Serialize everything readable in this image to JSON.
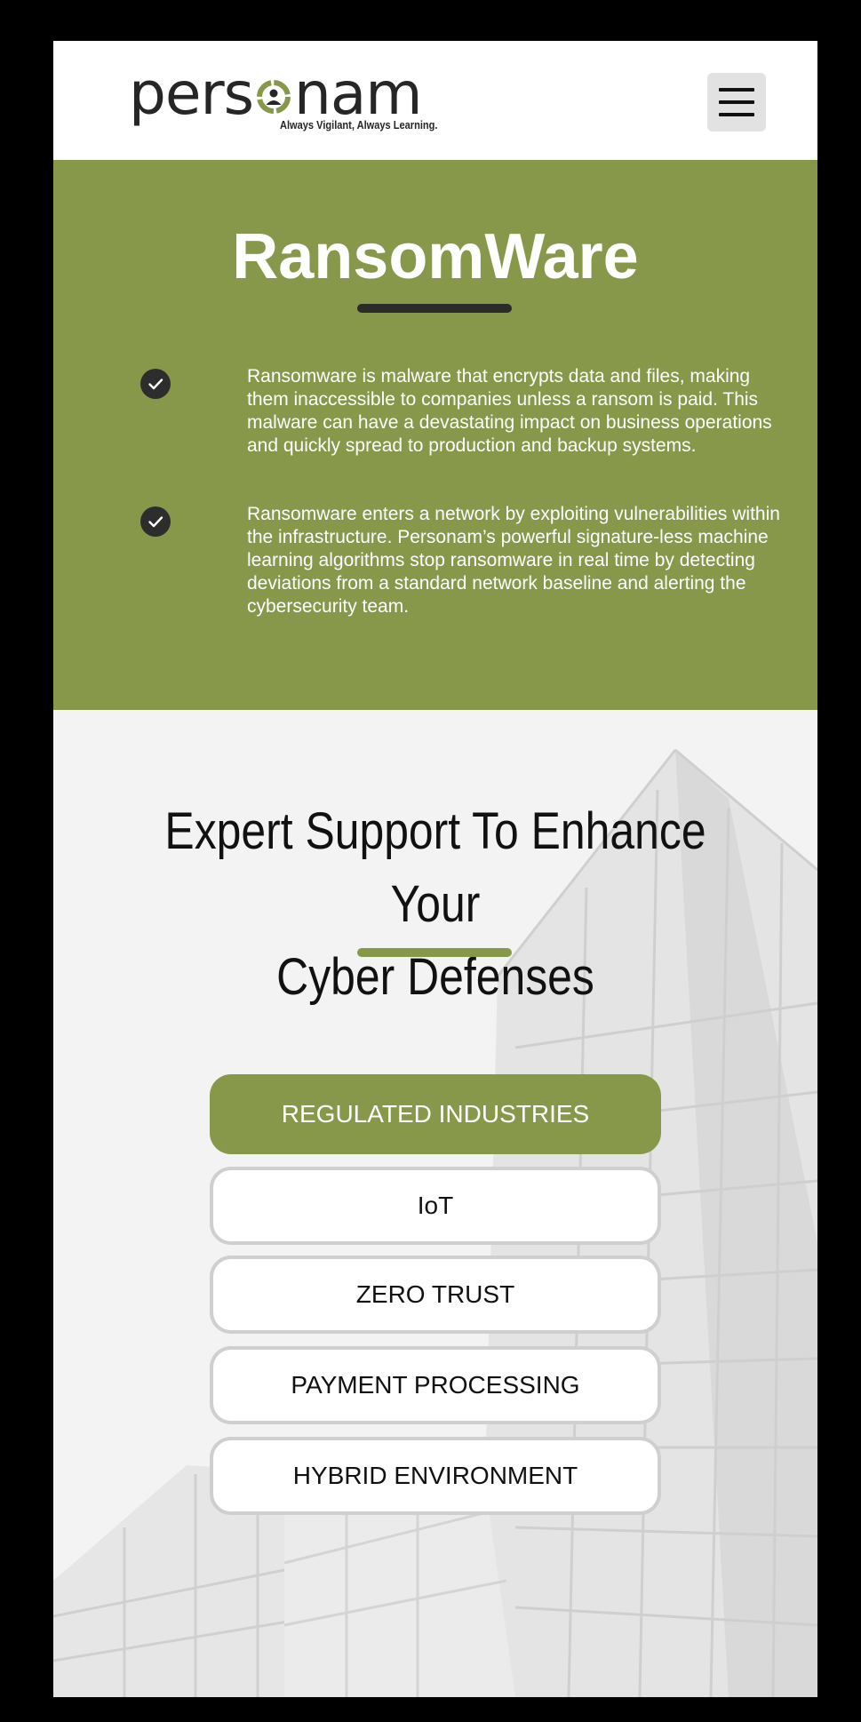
{
  "header": {
    "logo_text_before": "pers",
    "logo_text_after": "nam",
    "tagline": "Always Vigilant, Always Learning.",
    "menu_icon": "hamburger-menu-icon"
  },
  "ransomware": {
    "title": "RansomWare",
    "bullets": [
      "Ransomware is malware that encrypts data and files, making them inaccessible to companies unless a ransom is paid. This malware can have a devastating impact on business operations and quickly spread to production and backup systems.",
      "Ransomware enters a network by exploiting vulnerabilities within the infrastructure.  Personam’s powerful signature-less machine learning algorithms stop ransomware in real time by detecting deviations from a standard network baseline and alerting the cybersecurity team."
    ],
    "bullet_icon": "check-circle-icon"
  },
  "support": {
    "title_line1": "Expert Support To Enhance Your",
    "title_line2": "Cyber Defenses",
    "options": [
      {
        "label": "REGULATED INDUSTRIES",
        "active": true
      },
      {
        "label": "IoT",
        "active": false
      },
      {
        "label": "ZERO TRUST",
        "active": false
      },
      {
        "label": "PAYMENT PROCESSING",
        "active": false
      },
      {
        "label": "HYBRID ENVIRONMENT",
        "active": false
      }
    ]
  },
  "colors": {
    "accent_green": "#87984b",
    "dark": "#2b2b2b",
    "page_background": "#000000"
  }
}
